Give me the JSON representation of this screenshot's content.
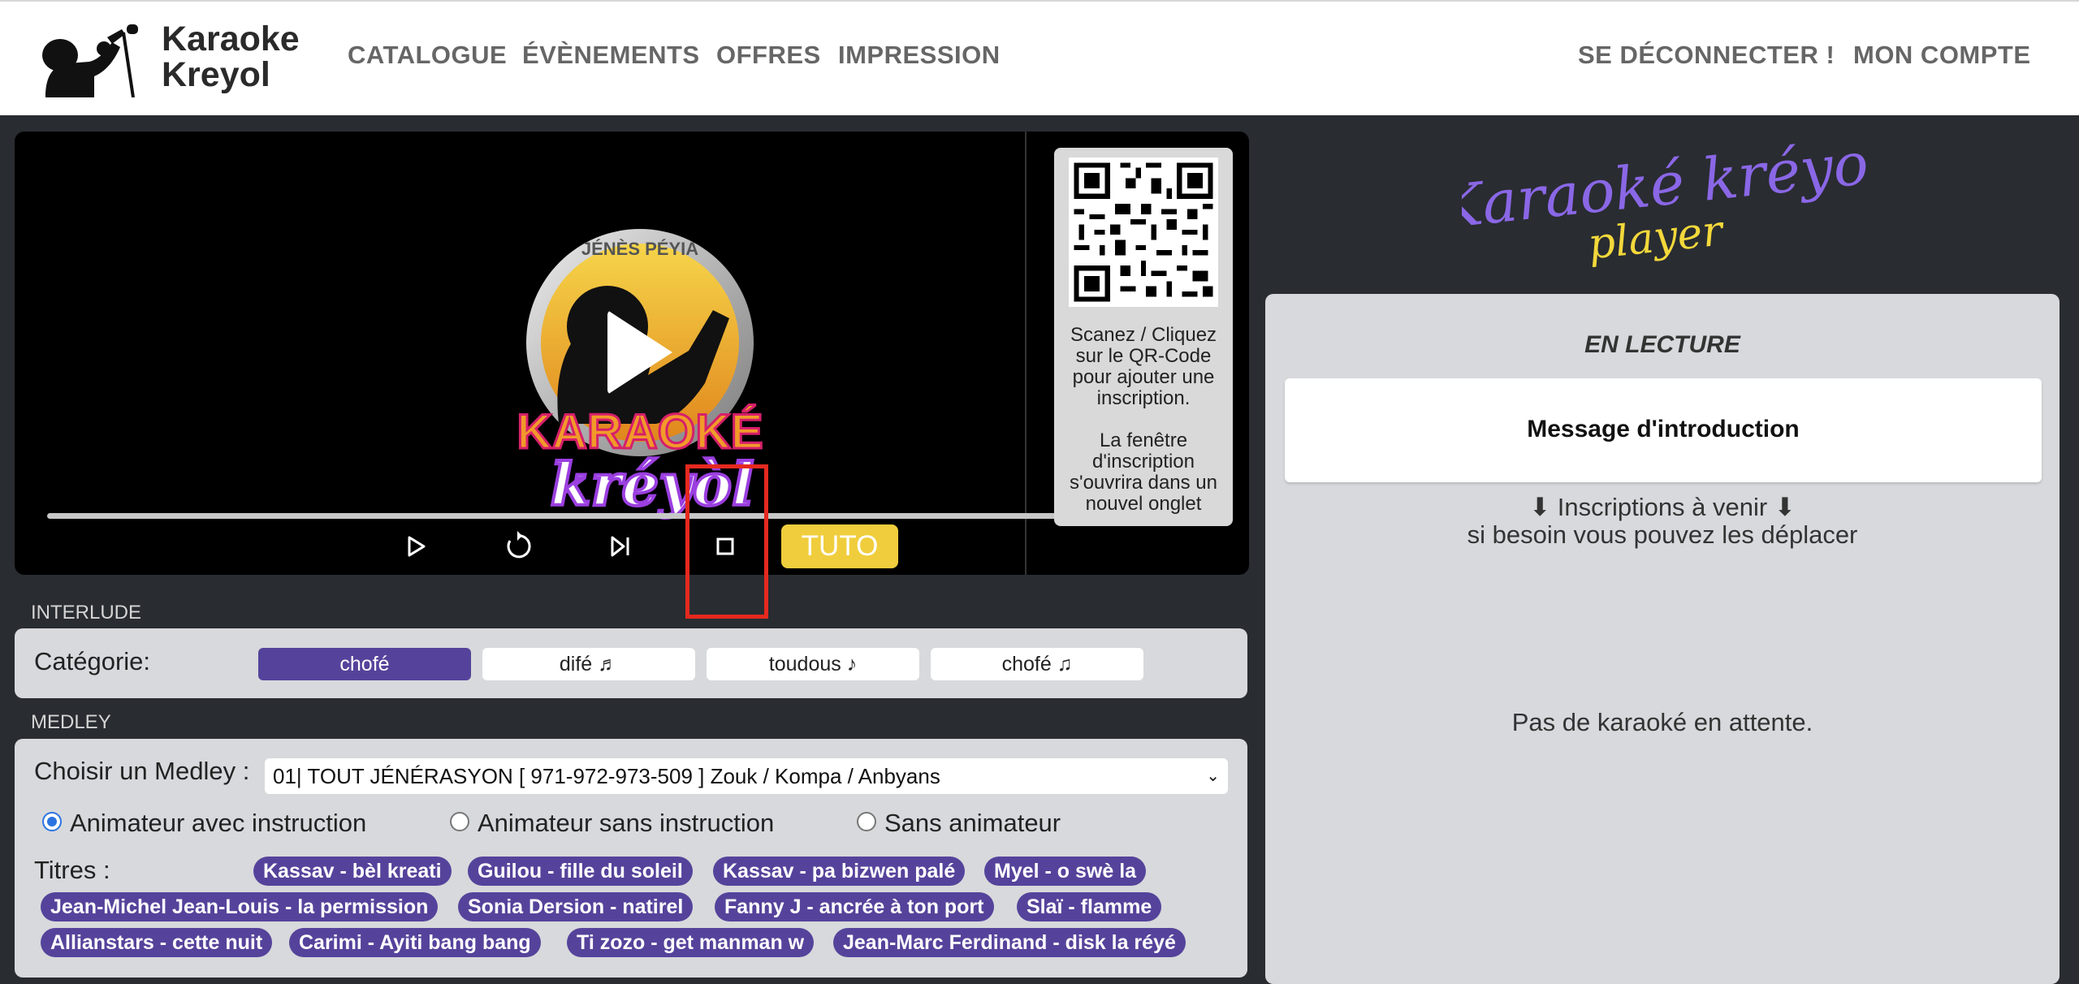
{
  "header": {
    "brand_line1": "Karaoke",
    "brand_line2": "Kreyol",
    "nav": [
      "CATALOGUE",
      "ÉVÈNEMENTS",
      "OFFRES",
      "IMPRESSION"
    ],
    "logout": "SE DÉCONNECTER !",
    "account": "MON COMPTE"
  },
  "video": {
    "logo_top_text": "JÉNÈS PÉYIA",
    "logo_word1": "KARAOKÉ",
    "logo_word2": "kréyòl",
    "controls": [
      "play-icon",
      "replay-icon",
      "skip-next-icon",
      "stop-icon"
    ],
    "tuto_label": "TUTO",
    "qr_text_1": "Scanez / Cliquez sur le QR-Code pour ajouter une inscription.",
    "qr_text_2": "La fenêtre d'inscription s'ouvrira dans un nouvel onglet"
  },
  "interlude": {
    "section_title": "INTERLUDE",
    "category_label": "Catégorie:",
    "categories": [
      "chofé",
      "difé ♬",
      "toudous ♪",
      "chofé ♫"
    ],
    "active_index": 0
  },
  "medley": {
    "section_title": "MEDLEY",
    "choose_label": "Choisir un Medley :",
    "selected": "01| TOUT JÉNÉRASYON [ 971-972-973-509 ] Zouk / Kompa / Anbyans",
    "radios": [
      "Animateur avec instruction",
      "Animateur sans instruction",
      "Sans animateur"
    ],
    "selected_radio": 0,
    "titres_label": "Titres :",
    "titles": [
      "Kassav - bèl kreati",
      "Guilou - fille du soleil",
      "Kassav - pa bizwen palé",
      "Myel - o swè la",
      "Jean-Michel Jean-Louis - la permission",
      "Sonia Dersion - natirel",
      "Fanny J - ancrée à ton port",
      "Slaï - flamme",
      "Allianstars - cette nuit",
      "Carimi - Ayiti bang bang",
      "Ti zozo - get manman w",
      "Jean-Marc Ferdinand - disk la réyé"
    ]
  },
  "player": {
    "logo_main": "Karaoké kréyol",
    "logo_sub": "player",
    "en_lecture": "EN LECTURE",
    "now_playing": "Message d'introduction",
    "inscriptions_line1": "⬇ Inscriptions à venir ⬇",
    "inscriptions_line2": "si besoin vous pouvez les déplacer",
    "empty": "Pas de karaoké en attente."
  },
  "colors": {
    "accent": "#55439b",
    "tuto": "#f0cd3c",
    "highlight": "#e5291f",
    "logo_purple": "#8a67e6",
    "logo_yellow": "#f3d83b"
  }
}
